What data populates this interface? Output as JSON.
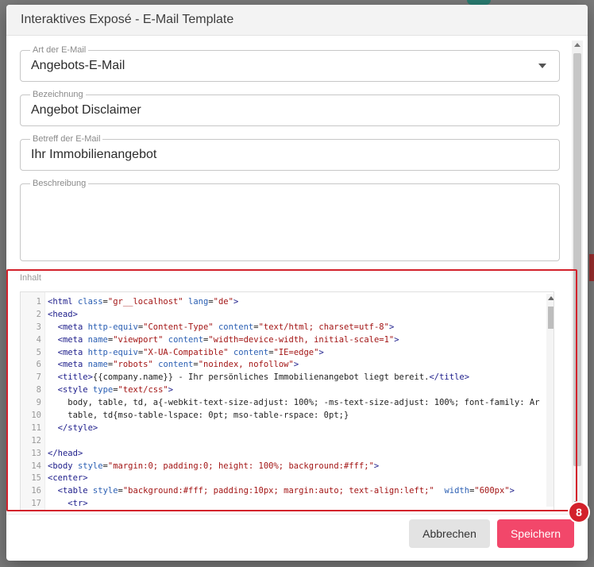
{
  "dialog": {
    "title": "Interaktives Exposé - E-Mail Template"
  },
  "form": {
    "mail_type": {
      "label": "Art der E-Mail",
      "value": "Angebots-E-Mail"
    },
    "name": {
      "label": "Bezeichnung",
      "value": "Angebot Disclaimer"
    },
    "subject": {
      "label": "Betreff der E-Mail",
      "value": "Ihr Immobilienangebot"
    },
    "description": {
      "label": "Beschreibung",
      "value": ""
    },
    "content": {
      "label": "Inhalt"
    }
  },
  "editor": {
    "line_numbers": [
      "1",
      "2",
      "3",
      "4",
      "5",
      "6",
      "7",
      "8",
      "9",
      "10",
      "11",
      "12",
      "13",
      "14",
      "15",
      "16",
      "17"
    ],
    "lines": [
      "<html class=\"gr__localhost\" lang=\"de\">",
      "<head>",
      "  <meta http-equiv=\"Content-Type\" content=\"text/html; charset=utf-8\">",
      "  <meta name=\"viewport\" content=\"width=device-width, initial-scale=1\">",
      "  <meta http-equiv=\"X-UA-Compatible\" content=\"IE=edge\">",
      "  <meta name=\"robots\" content=\"noindex, nofollow\">",
      "  <title>{{company.name}} - Ihr persönliches Immobilienangebot liegt bereit.</title>",
      "  <style type=\"text/css\">",
      "    body, table, td, a{-webkit-text-size-adjust: 100%; -ms-text-size-adjust: 100%; font-family: Ar",
      "    table, td{mso-table-lspace: 0pt; mso-table-rspace: 0pt;}",
      "  </style>",
      "",
      "</head>",
      "<body style=\"margin:0; padding:0; height: 100%; background:#fff;\">",
      "<center>",
      "  <table style=\"background:#fff; padding:10px; margin:auto; text-align:left;\"  width=\"600px\">",
      "    <tr>"
    ]
  },
  "annotation": {
    "step_number": "8"
  },
  "buttons": {
    "cancel": "Abbrechen",
    "save": "Speichern"
  },
  "colors": {
    "save_button": "#f2476a",
    "highlight": "#d3212b"
  }
}
